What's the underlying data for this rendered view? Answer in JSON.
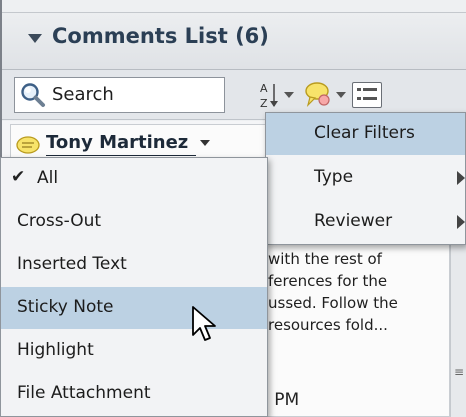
{
  "panel": {
    "title": "Comments List (6)",
    "search_label": "Search"
  },
  "comment": {
    "author": "Tony Martinez",
    "body_lines": [
      "with the rest of",
      "ferences for the",
      "ussed. Follow the",
      " resources fold..."
    ],
    "time": "3 PM"
  },
  "filter_menu": {
    "items": [
      {
        "label": "Clear Filters",
        "highlighted": true,
        "submenu": false
      },
      {
        "label": "Type",
        "highlighted": false,
        "submenu": true
      },
      {
        "label": "Reviewer",
        "highlighted": false,
        "submenu": true
      }
    ]
  },
  "type_menu": {
    "items": [
      {
        "label": "All",
        "checked": true,
        "highlighted": false
      },
      {
        "label": "Cross-Out",
        "checked": false,
        "highlighted": false
      },
      {
        "label": "Inserted Text",
        "checked": false,
        "highlighted": false
      },
      {
        "label": "Sticky Note",
        "checked": false,
        "highlighted": true
      },
      {
        "label": "Highlight",
        "checked": false,
        "highlighted": false
      },
      {
        "label": "File Attachment",
        "checked": false,
        "highlighted": false
      }
    ]
  },
  "colors": {
    "highlight": "#bcd1e3",
    "title": "#2b3f55",
    "menu_bg": "#f2f3f5"
  }
}
